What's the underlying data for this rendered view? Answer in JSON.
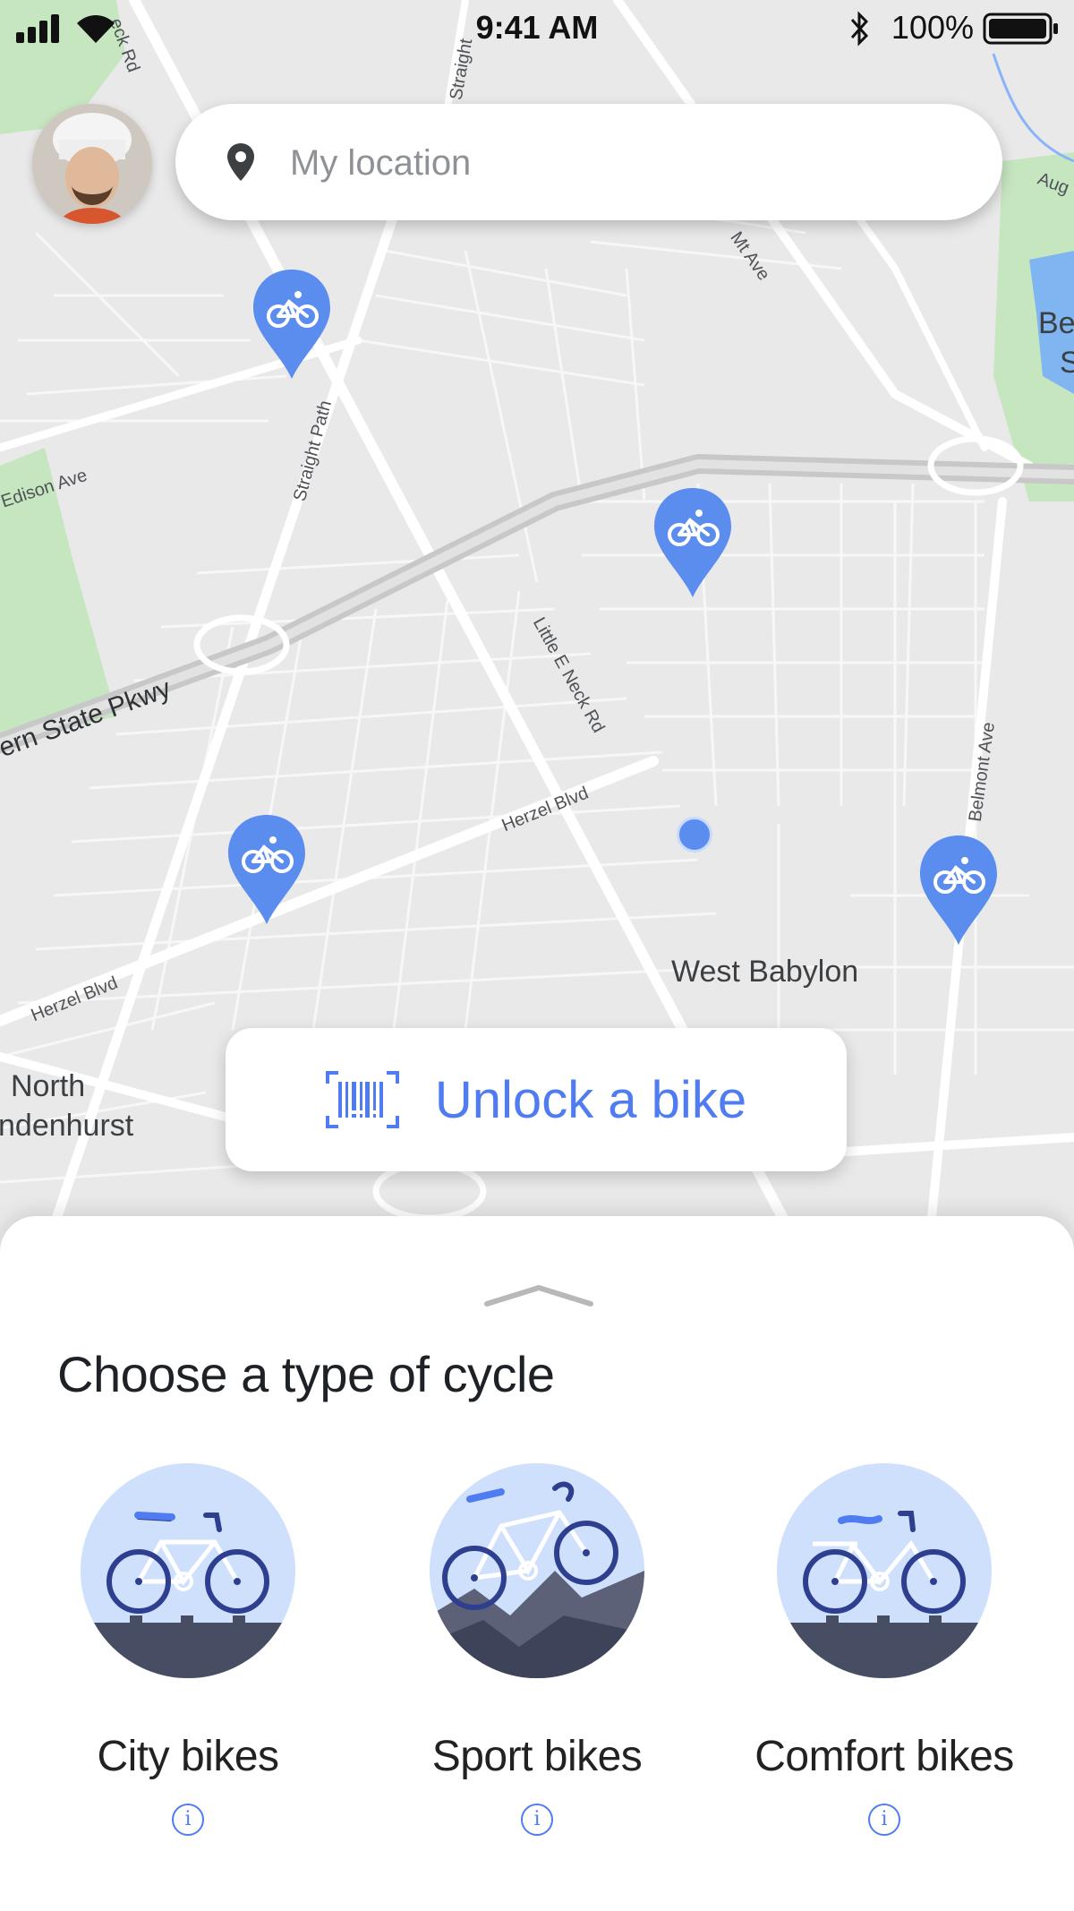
{
  "status_bar": {
    "time": "9:41 AM",
    "battery_percent": "100%",
    "icons": [
      "signal-icon",
      "wifi-icon",
      "bluetooth-icon",
      "battery-icon"
    ]
  },
  "search": {
    "placeholder": "My location",
    "icon": "location-pin-icon"
  },
  "map": {
    "streets": [
      "eck Rd",
      "Straight",
      "Mt Ave",
      "Aug",
      "Straight Path",
      "Edison Ave",
      "Little E Neck Rd",
      "ern State Pkwy",
      "Belmont Ave",
      "Herzel Blvd",
      "Herzel Blvd"
    ],
    "places": [
      "West Babylon",
      "North",
      "ndenhurst",
      "Be",
      "S"
    ],
    "bike_stations": 4,
    "bike_station_icon": "bicycle-icon",
    "accent_color": "#5b8def"
  },
  "unlock_button": {
    "label": "Unlock a bike",
    "icon": "barcode-scan-icon",
    "color": "#4f7cf0"
  },
  "sheet": {
    "title": "Choose a type of cycle",
    "types": [
      {
        "label": "City bikes",
        "info_icon": "i"
      },
      {
        "label": "Sport bikes",
        "info_icon": "i"
      },
      {
        "label": "Comfort bikes",
        "info_icon": "i"
      }
    ]
  }
}
